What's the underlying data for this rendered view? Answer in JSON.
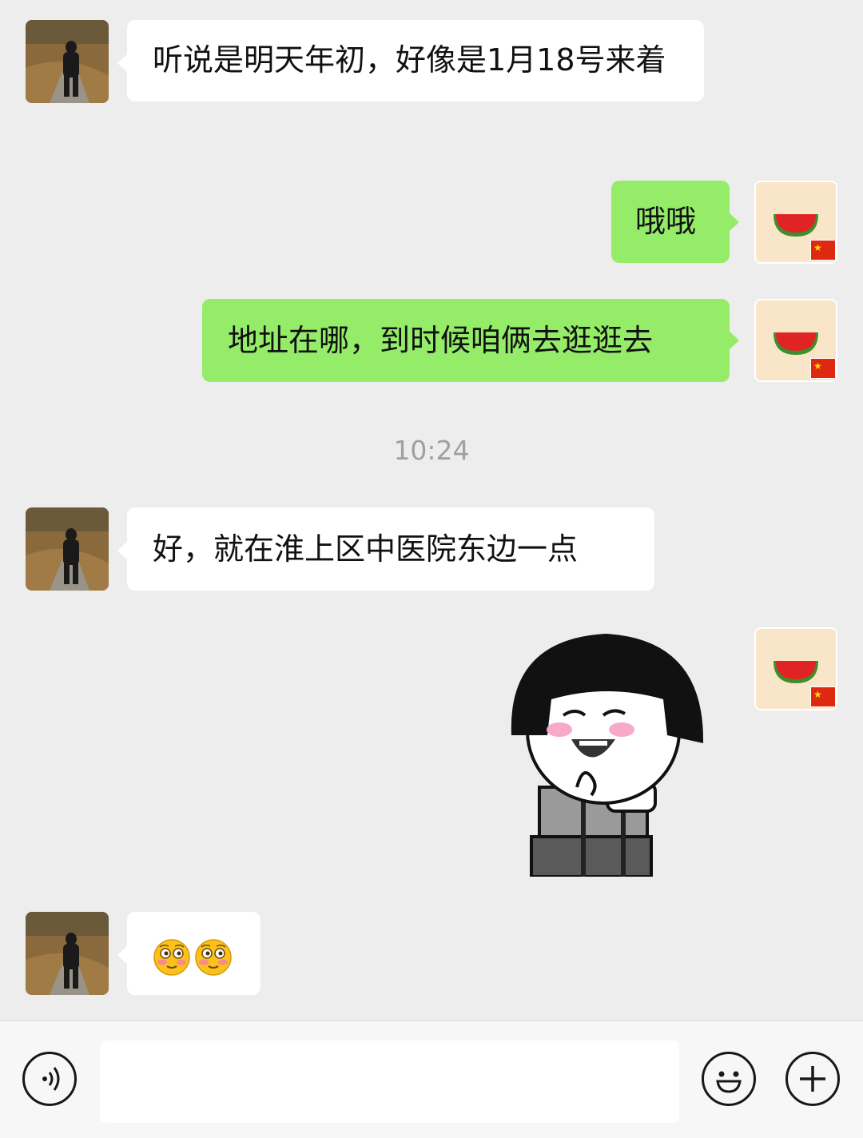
{
  "messages": [
    {
      "side": "in",
      "text": "听说是明天年初，好像是1月18号来着"
    },
    {
      "side": "out",
      "text": "哦哦"
    },
    {
      "side": "out",
      "text": "地址在哪，到时候咱俩去逛逛去"
    },
    {
      "side": "in",
      "text": "好，就在淮上区中医院东边一点"
    },
    {
      "side": "out",
      "sticker": "laughing-bowl-cut-meme-sticker"
    },
    {
      "side": "in",
      "emoji": [
        "flushed-emoji",
        "flushed-emoji"
      ]
    }
  ],
  "timestamp": "10:24",
  "input": {
    "value": "",
    "placeholder": ""
  },
  "icons": {
    "voice": "voice-icon",
    "emoji": "emoji-icon",
    "more": "plus-icon"
  },
  "colors": {
    "background": "#ededed",
    "incoming_bubble": "#ffffff",
    "outgoing_bubble": "#95ec69",
    "timestamp": "#a0a0a0"
  }
}
